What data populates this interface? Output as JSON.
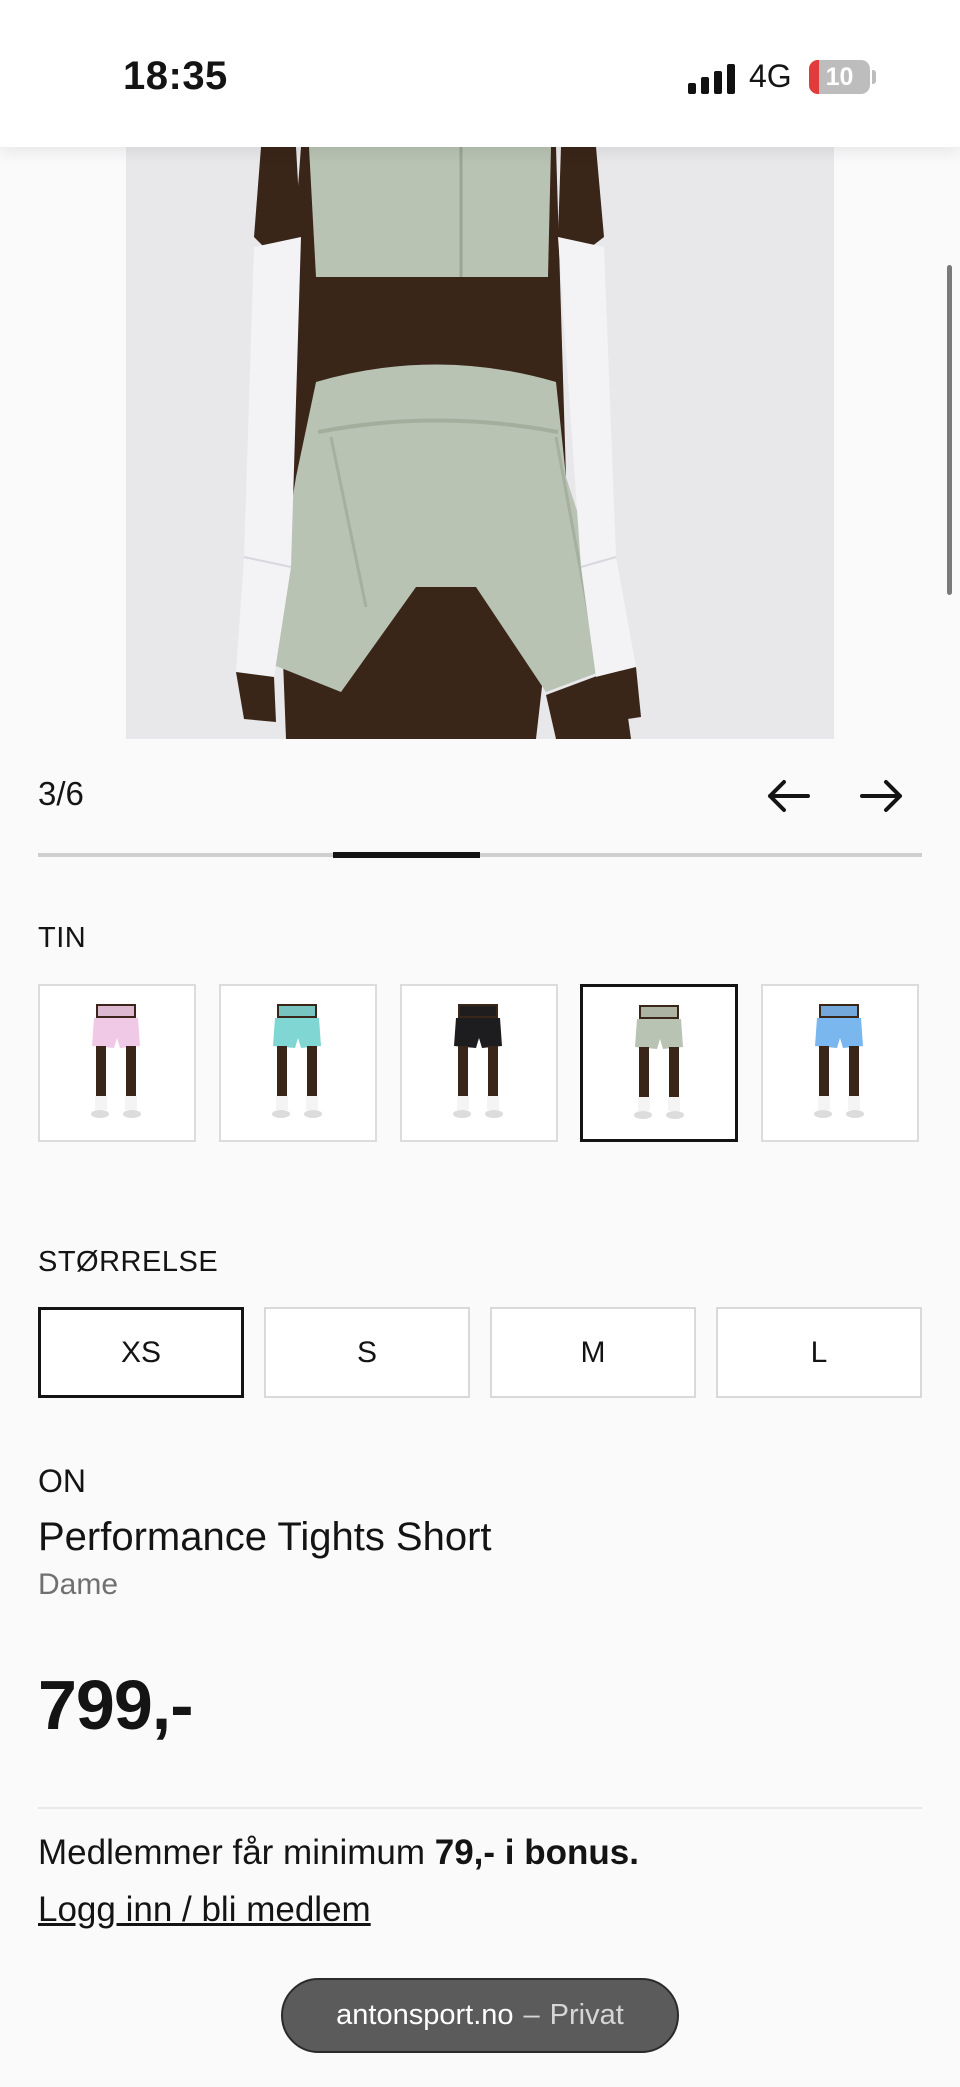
{
  "status_bar": {
    "time": "18:35",
    "network": "4G",
    "battery": "10",
    "battery_level": 0.1
  },
  "gallery": {
    "counter": "3/6",
    "current": 3,
    "total": 6,
    "prev_icon": "arrow-left-icon",
    "next_icon": "arrow-right-icon"
  },
  "color_section": {
    "label": "TIN",
    "swatches": [
      {
        "name": "pink",
        "color": "#f0c9e6"
      },
      {
        "name": "turquoise",
        "color": "#7fd6d3"
      },
      {
        "name": "black",
        "color": "#1d1d1f"
      },
      {
        "name": "tin",
        "color": "#b9c3b3",
        "selected": true
      },
      {
        "name": "light-blue",
        "color": "#7bb7ef"
      }
    ]
  },
  "size_section": {
    "label": "STØRRELSE",
    "sizes": [
      "XS",
      "S",
      "M",
      "L"
    ],
    "selected": "XS"
  },
  "product": {
    "brand": "ON",
    "name": "Performance Tights Short",
    "gender": "Dame",
    "price": "799,-"
  },
  "membership": {
    "text_prefix": "Medlemmer får minimum ",
    "bonus_amount": "79,- i bonus.",
    "login_link": "Logg inn / bli medlem"
  },
  "browser": {
    "domain": "antonsport.no",
    "separator": "–",
    "mode": "Privat"
  },
  "colors": {
    "accent": "#141414",
    "product_tint": "#b9c3b3",
    "skin": "#3a2519"
  }
}
